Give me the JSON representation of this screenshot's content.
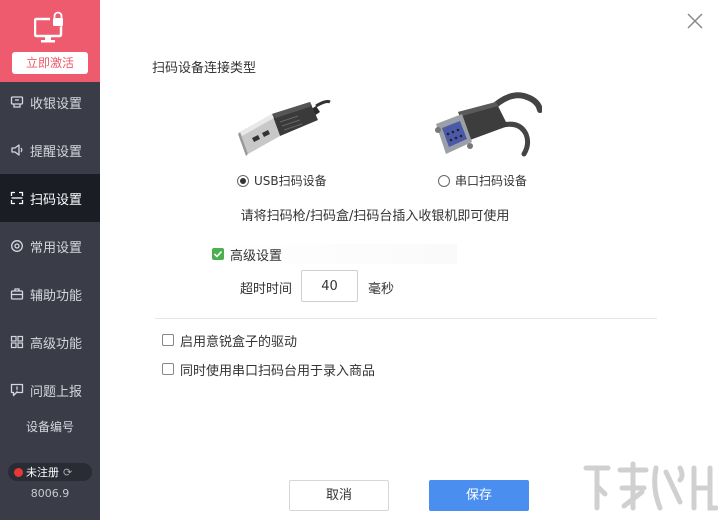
{
  "sidebar": {
    "activate_label": "立即激活",
    "items": [
      {
        "label": "收银设置",
        "icon": "cashier-icon",
        "active": false
      },
      {
        "label": "提醒设置",
        "icon": "speaker-icon",
        "active": false
      },
      {
        "label": "扫码设置",
        "icon": "scan-icon",
        "active": true
      },
      {
        "label": "常用设置",
        "icon": "gear-icon",
        "active": false
      },
      {
        "label": "辅助功能",
        "icon": "toolbox-icon",
        "active": false
      },
      {
        "label": "高级功能",
        "icon": "grid-icon",
        "active": false
      },
      {
        "label": "问题上报",
        "icon": "report-icon",
        "active": false
      }
    ],
    "device_no_label": "设备编号",
    "register_status": "未注册",
    "version": "8006.9"
  },
  "main": {
    "section_title": "扫码设备连接类型",
    "connection_options": [
      {
        "label": "USB扫码设备",
        "selected": true
      },
      {
        "label": "串口扫码设备",
        "selected": false
      }
    ],
    "hint": "请将扫码枪/扫码盒/扫码台插入收银机即可使用",
    "advanced": {
      "label": "高级设置",
      "checked": true
    },
    "timeout": {
      "label": "超时时间",
      "value": "40",
      "unit": "毫秒"
    },
    "options": [
      {
        "label": "启用意锐盒子的驱动",
        "checked": false
      },
      {
        "label": "同时使用串口扫码台用于录入商品",
        "checked": false
      }
    ],
    "cancel_label": "取消",
    "save_label": "保存"
  },
  "colors": {
    "brand": "#ee5a6e",
    "sidebar_bg": "#3a3d48",
    "active_bg": "#1b1d24",
    "primary": "#4a8ef0",
    "check": "#4caf50",
    "status_dot": "#e53935"
  }
}
